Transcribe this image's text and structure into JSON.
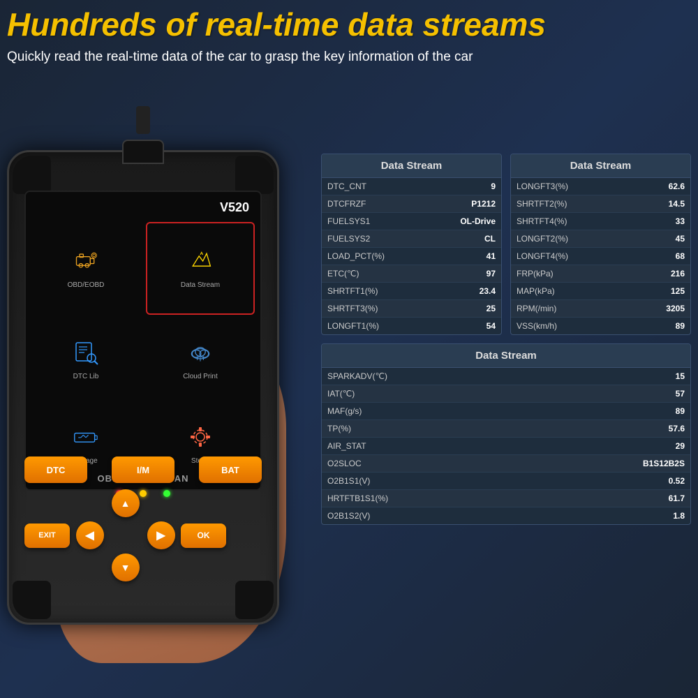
{
  "header": {
    "headline": "Hundreds of real-time data streams",
    "subtext": "Quickly read the real-time data of the car to grasp the key information of the car"
  },
  "device": {
    "model": "V520",
    "subtitle": "OBDII+EOBD+CAN",
    "menu_items": [
      {
        "id": "obd",
        "label": "OBD/EOBD",
        "icon": "engine"
      },
      {
        "id": "datastream",
        "label": "Data Stream",
        "icon": "chart",
        "highlighted": true
      },
      {
        "id": "dtclib",
        "label": "DTC Lib",
        "icon": "search"
      },
      {
        "id": "cloudprint",
        "label": "Cloud Print",
        "icon": "cloud"
      },
      {
        "id": "voltage",
        "label": "Voltage",
        "icon": "battery"
      },
      {
        "id": "steup",
        "label": "Steup",
        "icon": "gear"
      }
    ],
    "buttons": {
      "row1": [
        "DTC",
        "I/M",
        "BAT"
      ],
      "nav": {
        "exit": "EXIT",
        "ok": "OK",
        "up": "▲",
        "down": "▼",
        "left": "◀",
        "right": "▶"
      }
    },
    "leds": [
      "red",
      "yellow",
      "green"
    ]
  },
  "data_tables": {
    "table1": {
      "header": "Data Stream",
      "rows": [
        {
          "param": "DTC_CNT",
          "value": "9"
        },
        {
          "param": "DTCFRZF",
          "value": "P1212"
        },
        {
          "param": "FUELSYS1",
          "value": "OL-Drive"
        },
        {
          "param": "FUELSYS2",
          "value": "CL"
        },
        {
          "param": "LOAD_PCT(%)",
          "value": "41"
        },
        {
          "param": "ETC(℃)",
          "value": "97"
        },
        {
          "param": "SHRTFT1(%)",
          "value": "23.4"
        },
        {
          "param": "SHRTFT3(%)",
          "value": "25"
        },
        {
          "param": "LONGFT1(%)",
          "value": "54"
        }
      ]
    },
    "table2": {
      "header": "Data Stream",
      "rows": [
        {
          "param": "LONGFT3(%)",
          "value": "62.6"
        },
        {
          "param": "SHRTFT2(%)",
          "value": "14.5"
        },
        {
          "param": "SHRTFT4(%)",
          "value": "33"
        },
        {
          "param": "LONGFT2(%)",
          "value": "45"
        },
        {
          "param": "LONGFT4(%)",
          "value": "68"
        },
        {
          "param": "FRP(kPa)",
          "value": "216"
        },
        {
          "param": "MAP(kPa)",
          "value": "125"
        },
        {
          "param": "RPM(/min)",
          "value": "3205"
        },
        {
          "param": "VSS(km/h)",
          "value": "89"
        }
      ]
    },
    "table3": {
      "header": "Data Stream",
      "rows": [
        {
          "param": "SPARKADV(℃)",
          "value": "15"
        },
        {
          "param": "IAT(℃)",
          "value": "57"
        },
        {
          "param": "MAF(g/s)",
          "value": "89"
        },
        {
          "param": "TP(%)",
          "value": "57.6"
        },
        {
          "param": "AIR_STAT",
          "value": "29"
        },
        {
          "param": "O2SLOC",
          "value": "B1S12B2S"
        },
        {
          "param": "O2B1S1(V)",
          "value": "0.52"
        },
        {
          "param": "HRTFTB1S1(%)",
          "value": "61.7"
        },
        {
          "param": "O2B1S2(V)",
          "value": "1.8"
        }
      ]
    }
  }
}
